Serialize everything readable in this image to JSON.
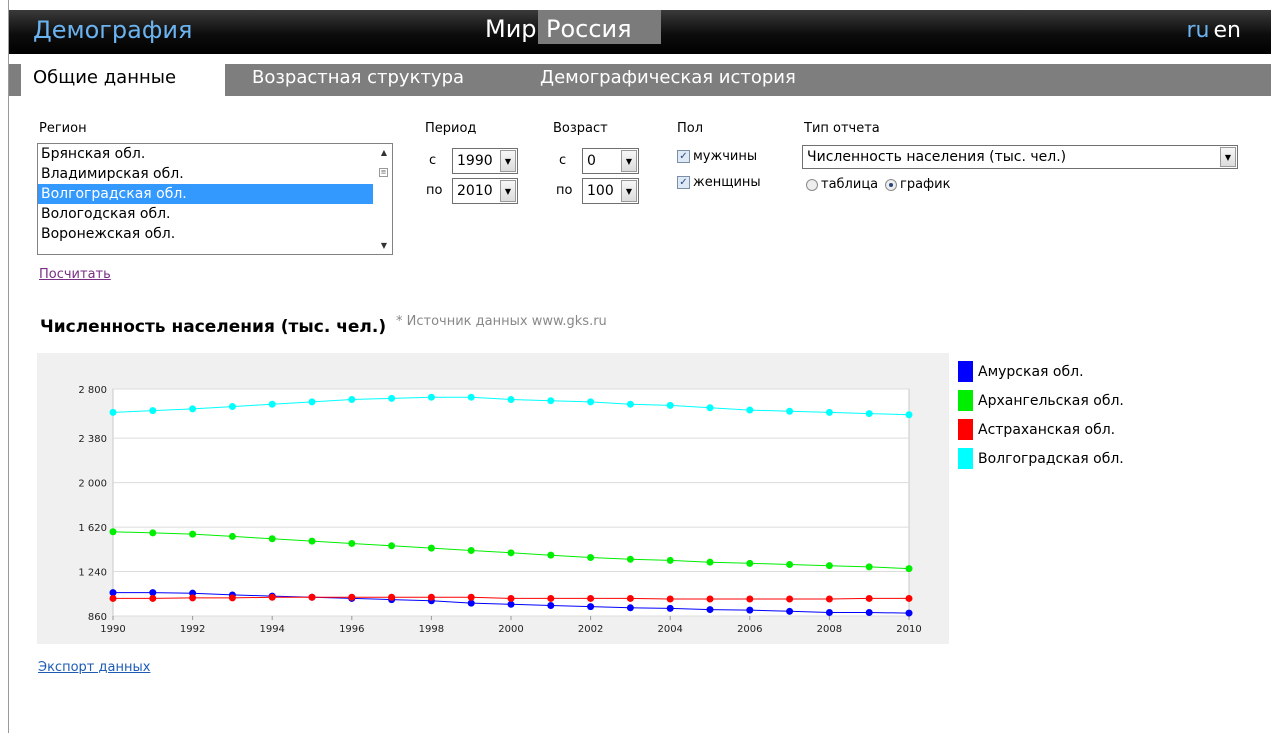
{
  "header": {
    "brand": "Демография",
    "nav_world": "Мир",
    "nav_russia": "Россия",
    "lang_ru": "ru",
    "lang_en": "en"
  },
  "tabs": [
    {
      "label": "Общие данные",
      "active": true
    },
    {
      "label": "Возрастная структура",
      "active": false
    },
    {
      "label": "Демографическая история",
      "active": false
    }
  ],
  "form": {
    "region_label": "Регион",
    "regions": [
      "Брянская обл.",
      "Владимирская обл.",
      "Волгоградская обл.",
      "Вологодская обл.",
      "Воронежская обл."
    ],
    "selected_region": "Волгоградская обл.",
    "period_label": "Период",
    "from_label": "с",
    "to_label": "по",
    "period_from": "1990",
    "period_to": "2010",
    "age_label": "Возраст",
    "age_from": "0",
    "age_to": "100",
    "sex_label": "Пол",
    "male_label": "мужчины",
    "female_label": "женщины",
    "male_checked": true,
    "female_checked": true,
    "report_type_label": "Тип отчета",
    "report_type_value": "Численность населения (тыс. чел.)",
    "table_label": "таблица",
    "chart_label": "график",
    "view_mode": "chart",
    "calculate_link": "Посчитать"
  },
  "chart_header": {
    "title": "Численность населения (тыс. чел.)",
    "source": "* Источник данных www.gks.ru"
  },
  "export_link": "Экспорт данных",
  "colors": {
    "brand": "#6bb3f0",
    "selection": "#3399ff",
    "link_visited": "#7a2e84",
    "link": "#1e5bb5"
  },
  "chart_data": {
    "type": "line",
    "x": [
      1990,
      1991,
      1992,
      1993,
      1994,
      1995,
      1996,
      1997,
      1998,
      1999,
      2000,
      2001,
      2002,
      2003,
      2004,
      2005,
      2006,
      2007,
      2008,
      2009,
      2010
    ],
    "ylim": [
      860,
      2800
    ],
    "yticks": [
      860,
      1240,
      1620,
      2000,
      2380,
      2800
    ],
    "ytick_labels": [
      "860",
      "1 240",
      "1 620",
      "2 000",
      "2 380",
      "2 800"
    ],
    "xticks": [
      1990,
      1992,
      1994,
      1996,
      1998,
      2000,
      2002,
      2004,
      2006,
      2008,
      2010
    ],
    "grid": true,
    "legend_position": "right",
    "series": [
      {
        "name": "Амурская обл.",
        "color": "#0000ff",
        "values": [
          1060,
          1060,
          1055,
          1040,
          1030,
          1020,
          1010,
          1000,
          990,
          970,
          960,
          950,
          940,
          930,
          925,
          915,
          910,
          900,
          890,
          890,
          885
        ]
      },
      {
        "name": "Архангельская обл.",
        "color": "#00ee00",
        "values": [
          1580,
          1570,
          1560,
          1540,
          1520,
          1500,
          1480,
          1460,
          1440,
          1420,
          1400,
          1380,
          1360,
          1345,
          1335,
          1320,
          1310,
          1300,
          1290,
          1280,
          1265
        ]
      },
      {
        "name": "Астраханская обл.",
        "color": "#ff0000",
        "values": [
          1010,
          1010,
          1015,
          1015,
          1020,
          1020,
          1020,
          1020,
          1020,
          1020,
          1010,
          1010,
          1010,
          1010,
          1005,
          1005,
          1005,
          1005,
          1005,
          1010,
          1010
        ]
      },
      {
        "name": "Волгоградская обл.",
        "color": "#00ffff",
        "values": [
          2600,
          2615,
          2630,
          2650,
          2670,
          2690,
          2710,
          2720,
          2730,
          2730,
          2710,
          2700,
          2690,
          2670,
          2660,
          2640,
          2620,
          2610,
          2600,
          2590,
          2580
        ]
      }
    ]
  }
}
